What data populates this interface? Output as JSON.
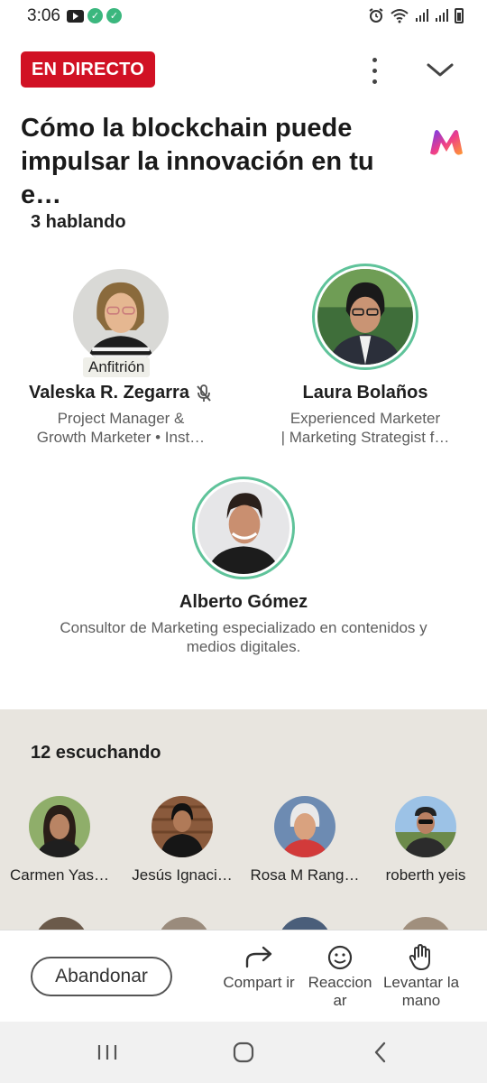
{
  "status_bar": {
    "time": "3:06",
    "left_icons": [
      "youtube-icon",
      "check-circle-icon",
      "check-circle-icon"
    ],
    "right_icons": [
      "alarm-icon",
      "wifi-icon",
      "signal-icon",
      "signal-icon",
      "battery-icon"
    ]
  },
  "header": {
    "live_badge": "EN DIRECTO",
    "title": "Cómo la blockchain puede impulsar la innovación en tu e…"
  },
  "speakers_section": {
    "heading": "3 hablando",
    "speakers": [
      {
        "name": "Valeska R. Zegarra",
        "bio_line1": "Project Manager &",
        "bio_line2": "Growth Marketer • Inst…",
        "tag": "Anfitrión",
        "muted": true
      },
      {
        "name": "Laura Bolaños",
        "bio_line1": "Experienced Marketer",
        "bio_line2": "| Marketing Strategist f…",
        "muted": false
      },
      {
        "name": "Alberto Gómez",
        "bio_line1": "Consultor de Marketing especializado en contenidos y",
        "bio_line2": "medios digitales.",
        "muted": false
      }
    ]
  },
  "listeners_section": {
    "heading": "12 escuchando",
    "listeners": [
      {
        "name": "Carmen Yas…"
      },
      {
        "name": "Jesús Ignaci…"
      },
      {
        "name": "Rosa M Rang…"
      },
      {
        "name": "roberth yeis"
      }
    ]
  },
  "action_bar": {
    "leave_label": "Abandonar",
    "share_label": "Compart ir",
    "react_label": "Reaccion ar",
    "raise_hand_label": "Levantar la mano"
  },
  "colors": {
    "live_red": "#d11124",
    "speaking_ring": "#5fc39a",
    "audience_bg": "#e8e5df"
  }
}
